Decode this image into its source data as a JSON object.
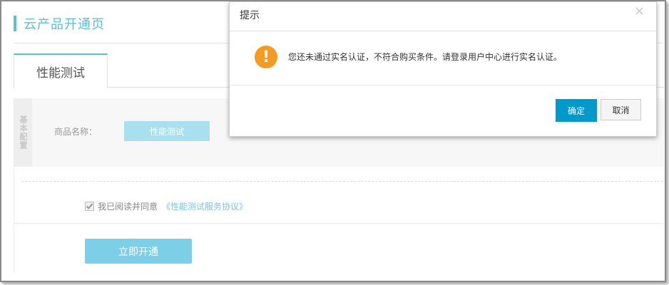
{
  "page": {
    "title": "云产品开通页",
    "tab_label": "性能测试"
  },
  "config": {
    "side_label": "基本配置",
    "product_name_label": "商品名称：",
    "product_name_value": "性能测试"
  },
  "agreement": {
    "checked": true,
    "text": "我已阅读并同意",
    "link_text": "《性能测试服务协议》"
  },
  "actions": {
    "open_label": "立即开通"
  },
  "modal": {
    "title": "提示",
    "close_symbol": "×",
    "icon": "warning-icon",
    "icon_glyph": "!",
    "message": "您还未通过实名认证，不符合购买条件。请登录用户中心进行实名认证。",
    "confirm_label": "确定",
    "cancel_label": "取消"
  },
  "colors": {
    "accent": "#5bbfdc",
    "confirm": "#0099cc",
    "warning": "#f59a23"
  }
}
